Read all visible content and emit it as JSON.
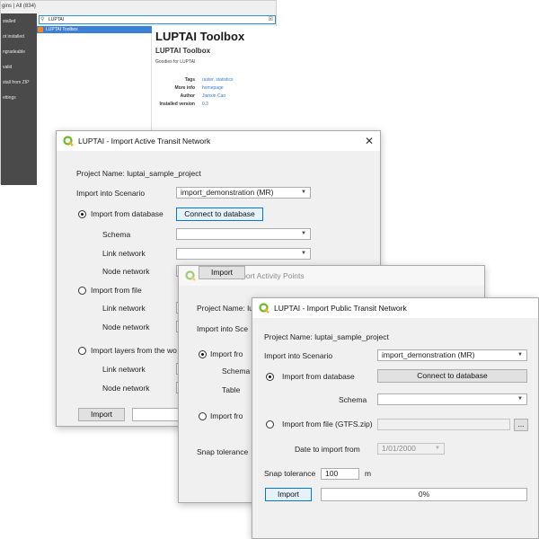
{
  "plugin_manager": {
    "title": "gins | All (834)",
    "sidebar": [
      "stalled",
      "ot installed",
      "ngradeable",
      "valid",
      "stall from ZIP",
      "ettings"
    ],
    "search": {
      "value": "LUPTAI"
    },
    "list": [
      {
        "label": "LUPTAI Toolbox"
      }
    ],
    "detail": {
      "heading": "LUPTAI Toolbox",
      "subheading": "LUPTAI Toolbox",
      "description": "Goodies for LUPTAI",
      "meta": [
        {
          "key": "Tags",
          "value": "raster, statistics"
        },
        {
          "key": "More info",
          "value": "homepage"
        },
        {
          "key": "Author",
          "value": "Jianxin Cao"
        },
        {
          "key": "Installed version",
          "value": "0.3"
        }
      ]
    }
  },
  "dialog_active": {
    "title": "LUPTAI - Import Active Transit Network",
    "project_name": "Project Name: luptai_sample_project",
    "scenario_label": "Import into Scenario",
    "scenario_value": "import_demonstration (MR)",
    "from_db_label": "Import from database",
    "connect_label": "Connect to database",
    "schema_label": "Schema",
    "link_label": "Link network",
    "node_label": "Node network",
    "from_file_label": "Import from file",
    "link_label2": "Link network",
    "node_label2": "Node network",
    "from_layers_label": "Import layers from the wo",
    "link_label3": "Link network",
    "node_label3": "Node network",
    "import_label": "Import"
  },
  "dialog_activity": {
    "title": "LUPTAI - Import Activity Points",
    "project_name": "Project Name: lu",
    "scenario_label": "Import into Sce",
    "from_db_label": "Import fro",
    "schema_label": "Schema",
    "table_label": "Table",
    "from_file_label": "Import fro",
    "snap_label": "Snap tolerance",
    "import_label": "Import"
  },
  "dialog_public": {
    "title": "LUPTAI - Import Public Transit Network",
    "project_name": "Project Name: luptai_sample_project",
    "scenario_label": "Import into Scenario",
    "scenario_value": "import_demonstration (MR)",
    "from_db_label": "Import from database",
    "connect_label": "Connect to database",
    "schema_label": "Schema",
    "from_file_label": "Import from file (GTFS.zip)",
    "browse_label": "...",
    "date_label": "Date to import from",
    "date_value": "1/01/2000",
    "snap_label": "Snap tolerance",
    "snap_value": "100",
    "snap_unit": "m",
    "import_label": "Import",
    "progress": 0,
    "progress_text": "0%"
  }
}
